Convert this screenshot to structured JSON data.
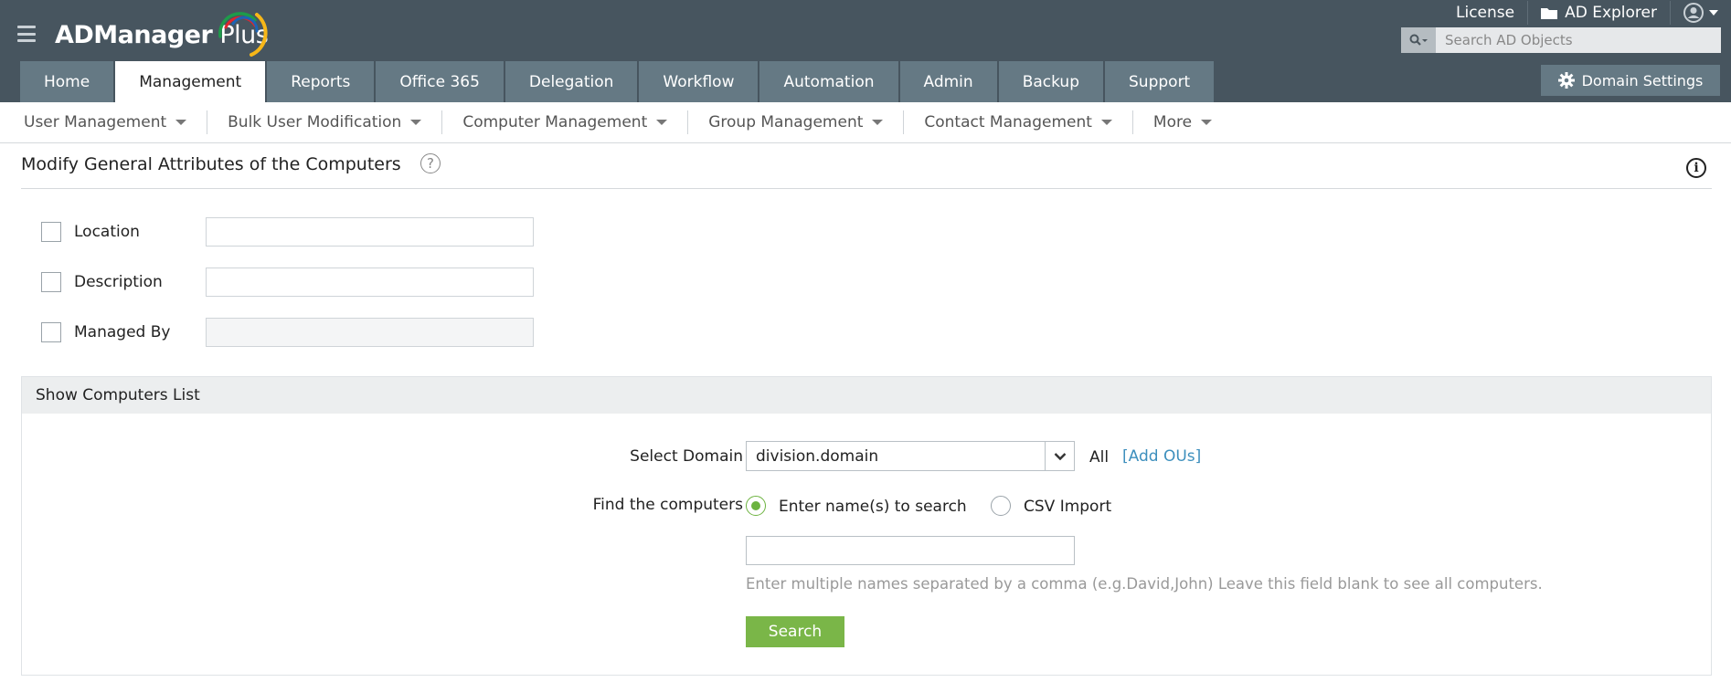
{
  "app": {
    "name_bold": "ADManager",
    "name_rest": " Plus",
    "brand_colors": [
      "#1e9b4a",
      "#e1252b",
      "#1c64b5",
      "#f7b718"
    ]
  },
  "header": {
    "license_label": "License",
    "ad_explorer_label": "AD Explorer",
    "search_placeholder": "Search AD Objects",
    "domain_settings_label": "Domain Settings"
  },
  "tabs": [
    {
      "label": "Home",
      "active": false
    },
    {
      "label": "Management",
      "active": true
    },
    {
      "label": "Reports",
      "active": false
    },
    {
      "label": "Office 365",
      "active": false
    },
    {
      "label": "Delegation",
      "active": false
    },
    {
      "label": "Workflow",
      "active": false
    },
    {
      "label": "Automation",
      "active": false
    },
    {
      "label": "Admin",
      "active": false
    },
    {
      "label": "Backup",
      "active": false
    },
    {
      "label": "Support",
      "active": false
    }
  ],
  "submenu": [
    {
      "label": "User Management"
    },
    {
      "label": "Bulk User Modification"
    },
    {
      "label": "Computer Management"
    },
    {
      "label": "Group Management"
    },
    {
      "label": "Contact Management"
    },
    {
      "label": "More"
    }
  ],
  "page": {
    "title": "Modify General Attributes of the Computers",
    "help_glyph": "?",
    "info_glyph": "i"
  },
  "attributes": [
    {
      "label": "Location",
      "value": "",
      "checked": false
    },
    {
      "label": "Description",
      "value": "",
      "checked": false
    },
    {
      "label": "Managed By",
      "value": "",
      "checked": false
    }
  ],
  "computers_panel": {
    "heading": "Show Computers List",
    "select_domain_label": "Select Domain",
    "domain_value": "division.domain",
    "all_label": "All",
    "add_ous_label": "[Add OUs]",
    "find_label": "Find the computers",
    "option_names": "Enter name(s) to search",
    "option_csv": "CSV Import",
    "selected_option": "names",
    "names_value": "",
    "hint": "Enter multiple names separated by a comma (e.g.David,John) Leave this field blank to see all computers.",
    "search_button": "Search"
  },
  "colors": {
    "header_bg": "#47555f",
    "tab_bg": "#657984",
    "accent_green": "#7ab648",
    "link_blue": "#3d8fbd"
  }
}
